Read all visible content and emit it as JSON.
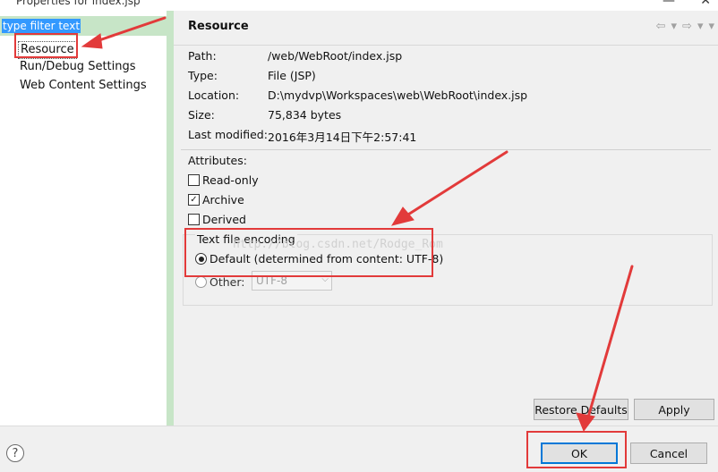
{
  "window": {
    "title": "Properties for index.jsp",
    "minimize_glyph": "—",
    "close_glyph": "✕"
  },
  "left_pane": {
    "filter_text": "type filter text",
    "items": [
      {
        "label": "Resource"
      },
      {
        "label": "Run/Debug Settings"
      },
      {
        "label": "Web Content Settings"
      }
    ]
  },
  "header": {
    "title": "Resource",
    "nav": {
      "back_glyph": "⇦",
      "back_menu_glyph": "▾",
      "forward_glyph": "⇨",
      "forward_menu_glyph": "▾",
      "menu_glyph": "▾"
    }
  },
  "properties": [
    {
      "label": "Path:",
      "value": "/web/WebRoot/index.jsp"
    },
    {
      "label": "Type:",
      "value": "File  (JSP)"
    },
    {
      "label": "Location:",
      "value": "D:\\mydvp\\Workspaces\\web\\WebRoot\\index.jsp"
    },
    {
      "label": "Size:",
      "value": "75,834  bytes"
    },
    {
      "label": "Last modified:",
      "value": "2016年3月14日下午2:57:41"
    }
  ],
  "attributes": {
    "label": "Attributes:",
    "read_only": {
      "label": "Read-only",
      "checked": false
    },
    "archive": {
      "label": "Archive",
      "checked": true,
      "check_glyph": "✓"
    },
    "derived": {
      "label": "Derived",
      "checked": false
    }
  },
  "encoding": {
    "group_title": "Text file encoding",
    "default_label": "Default (determined from content: UTF-8)",
    "other_label": "Other:",
    "other_value": "UTF-8",
    "dropdown_glyph": "⌵"
  },
  "watermark": "http://blog.csdn.net/Rodge_Rom",
  "buttons": {
    "restore_defaults": "Restore Defaults",
    "apply": "Apply",
    "ok": "OK",
    "cancel": "Cancel",
    "help": "?"
  },
  "colors": {
    "annotation_red": "#e23a3a",
    "selection_blue": "#3399ff",
    "pane_divider_green": "#c7e5c7",
    "focus_blue": "#0078d7"
  }
}
